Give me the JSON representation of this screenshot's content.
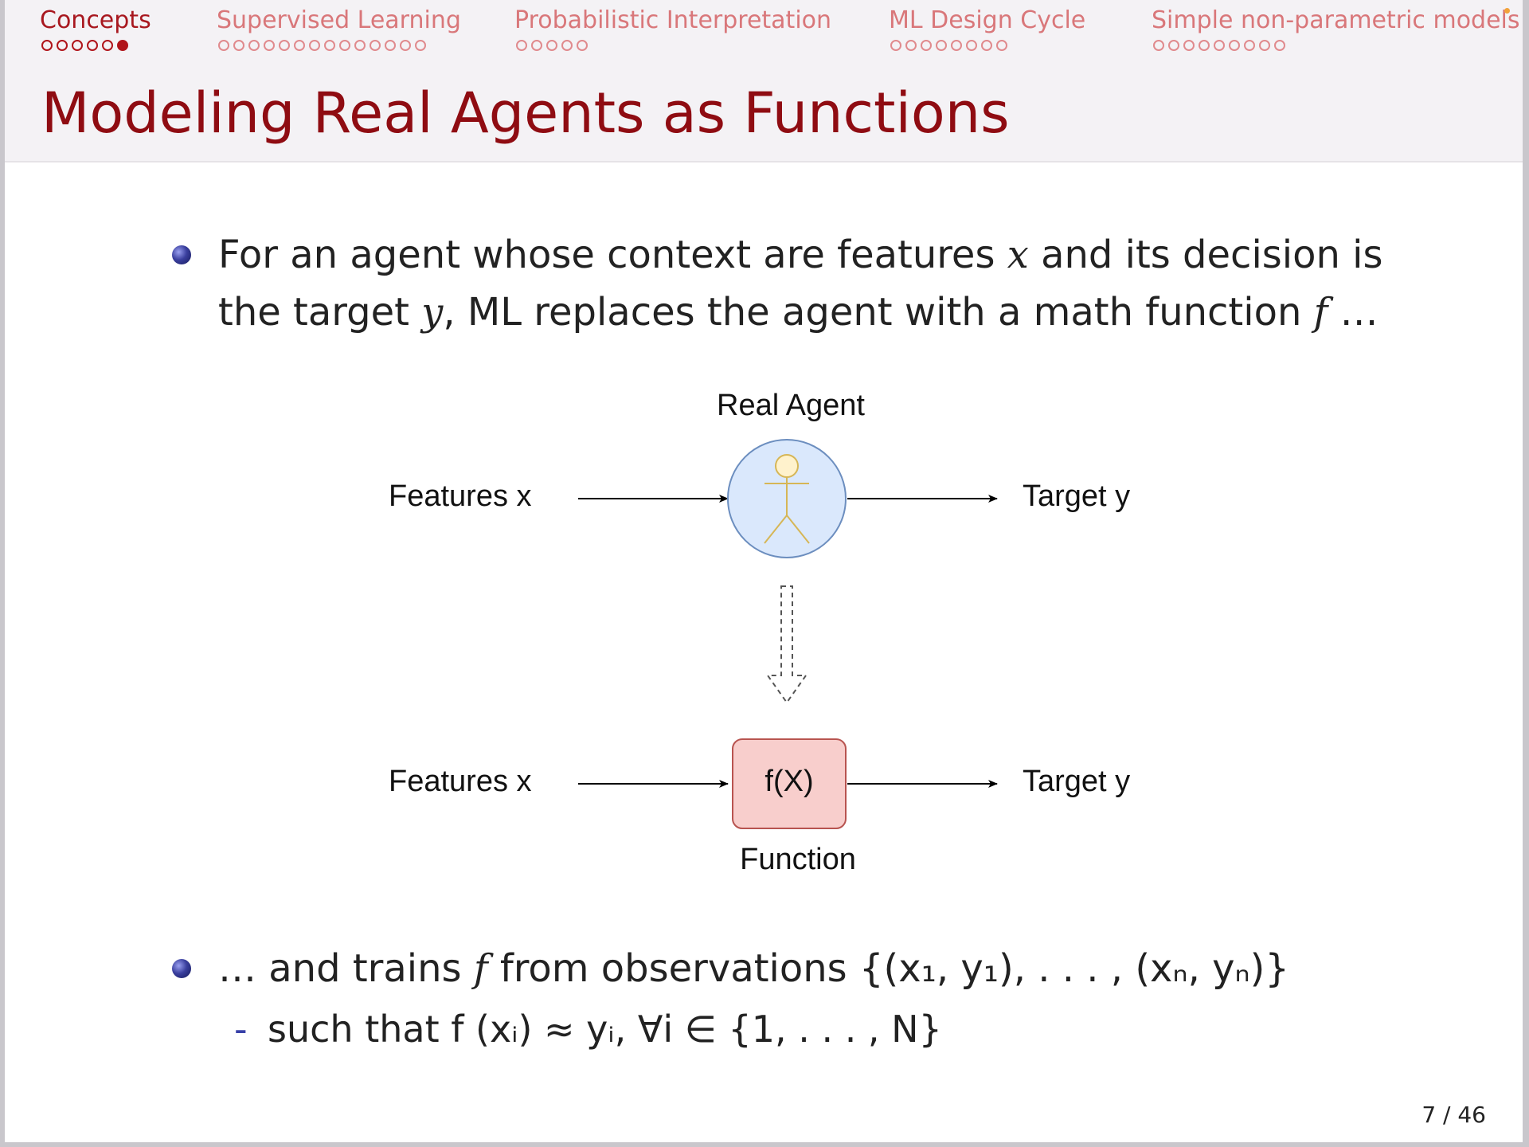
{
  "nav": {
    "sections": [
      {
        "label": "Concepts",
        "dots": 6,
        "filled": 5,
        "active": true
      },
      {
        "label": "Supervised Learning",
        "dots": 14,
        "filled": -1,
        "active": false
      },
      {
        "label": "Probabilistic Interpretation",
        "dots": 5,
        "filled": -1,
        "active": false
      },
      {
        "label": "ML Design Cycle",
        "dots": 8,
        "filled": -1,
        "active": false
      },
      {
        "label": "Simple non-parametric models",
        "dots": 9,
        "filled": -1,
        "active": false
      }
    ]
  },
  "slide": {
    "title": "Modeling Real Agents as Functions",
    "bullet1": {
      "part1": "For an agent whose context are features ",
      "var_x": "x",
      "part2": " and its decision is the target ",
      "var_y": "y",
      "part3": ", ML replaces the agent with a math function ",
      "var_f": "f",
      "part4": " …"
    },
    "bullet2": {
      "part1": "… and trains ",
      "var_f": "f",
      "part2": " from observations ",
      "set": "{(x₁, y₁), . . . , (xₙ, yₙ)}"
    },
    "sub_bullet": {
      "dash": "-",
      "part1": "such that ",
      "formula": "f (xᵢ) ≈ yᵢ,  ∀i ∈ {1, . . . , N}"
    },
    "page": "7 / 46"
  },
  "diagram": {
    "agent_title": "Real Agent",
    "features_top": "Features x",
    "target_top": "Target y",
    "features_bottom": "Features x",
    "target_bottom": "Target y",
    "function_text": "f(X)",
    "function_caption": "Function",
    "colors": {
      "agent_fill": "#dae8fc",
      "agent_stroke": "#6c8ebf",
      "stick_figure": "#d6b656",
      "head_fill": "#fff2cc",
      "function_fill": "#f8cecc",
      "function_stroke": "#b85450"
    }
  }
}
